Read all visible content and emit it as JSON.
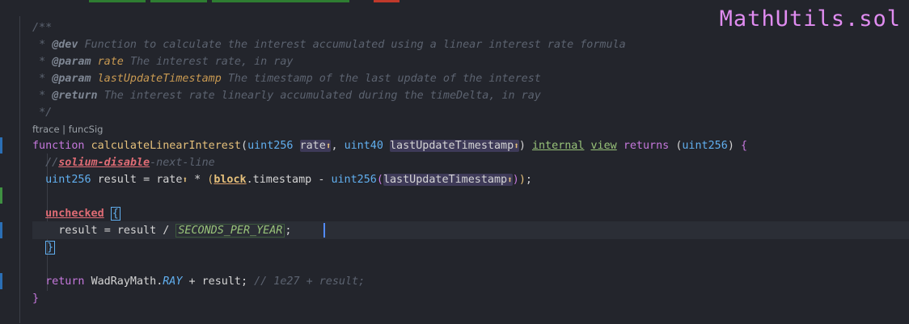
{
  "file": {
    "name": "MathUtils.sol"
  },
  "codelens": "ftrace | funcSig",
  "doc": {
    "open": "/**",
    "dev_tag": "@dev",
    "dev_text": "Function to calculate the interest accumulated using a linear interest rate formula",
    "param_tag": "@param",
    "p1_name": "rate",
    "p1_text": "The interest rate, in ray",
    "p2_name": "lastUpdateTimestamp",
    "p2_text": "The timestamp of the last update of the interest",
    "return_tag": "@return",
    "return_text": "The interest rate linearly accumulated during the timeDelta, in ray",
    "close": "*/",
    "star": "*"
  },
  "code": {
    "function_kw": "function",
    "fn_name": "calculateLinearInterest",
    "open_paren": "(",
    "uint256": "uint256",
    "rate": "rate",
    "arrow": "⬆",
    "comma": ",",
    "uint40": "uint40",
    "last_ts": "lastUpdateTimestamp",
    "close_paren": ")",
    "internal": "internal",
    "view": "view",
    "returns": "returns",
    "ret_type": "uint256",
    "open_brace": "{",
    "close_brace": "}",
    "solium_slashes": "//",
    "solium": "solium-disable",
    "solium_rest": "-next-line",
    "result": "result",
    "eq": "=",
    "mul": "*",
    "block": "block",
    "timestamp": ".timestamp",
    "minus": "-",
    "semi": ";",
    "unchecked": "unchecked",
    "div": "/",
    "seconds_per_year": "SECONDS_PER_YEAR",
    "return_kw": "return",
    "wadray": "WadRayMath",
    "dot": ".",
    "ray_const": "RAY",
    "plus": "+",
    "trailing_comment": "// 1e27 + result;"
  },
  "colors": {
    "background": "#23252c",
    "keyword": "#c678dd",
    "function": "#e5c07b",
    "type": "#61afef",
    "comment": "#5c6370",
    "title": "#e08cf0"
  }
}
